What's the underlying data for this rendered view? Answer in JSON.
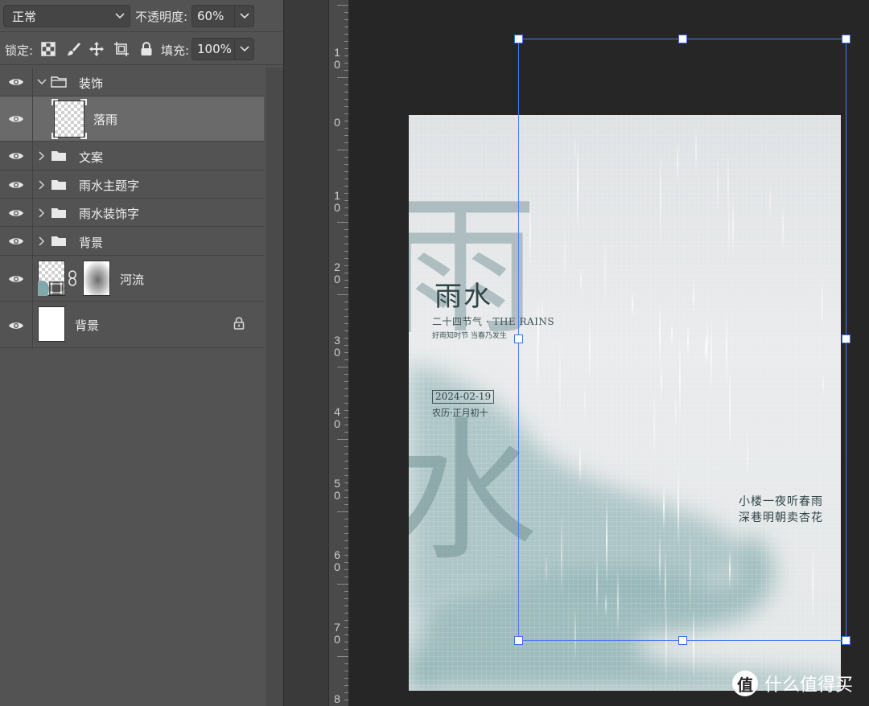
{
  "top_bar": {
    "blend_mode": "正常",
    "opacity_label": "不透明度:",
    "opacity_value": "60%",
    "lock_label": "锁定:",
    "fill_label": "填充:",
    "fill_value": "100%"
  },
  "layers": [
    {
      "name": "装饰",
      "type": "group",
      "expanded": true,
      "visible": true
    },
    {
      "name": "落雨",
      "type": "layer",
      "selected": true,
      "visible": true
    },
    {
      "name": "文案",
      "type": "group",
      "expanded": false,
      "visible": true
    },
    {
      "name": "雨水主题字",
      "type": "group",
      "expanded": false,
      "visible": true
    },
    {
      "name": "雨水装饰字",
      "type": "group",
      "expanded": false,
      "visible": true
    },
    {
      "name": "背景",
      "type": "group",
      "expanded": false,
      "visible": true
    },
    {
      "name": "河流",
      "type": "layer",
      "has_mask": true,
      "visible": true
    },
    {
      "name": "背景",
      "type": "layer",
      "locked": true,
      "visible": true
    }
  ],
  "ruler": {
    "labels": [
      "1 0",
      "0",
      "1 0",
      "2 0",
      "3 0",
      "4 0",
      "5 0",
      "6 0",
      "7 0",
      "8"
    ]
  },
  "poster": {
    "big_char_1": "雨",
    "big_char_2": "水",
    "title": "雨水",
    "subtitle": "二十四节气 · THE RAINS",
    "tagline": "好雨知时节 当春乃发生",
    "date": "2024-02-19",
    "lunar": "农历·正月初十",
    "poem_line_1": "小楼一夜听春雨",
    "poem_line_2": "深巷明朝卖杏花"
  },
  "watermark": {
    "logo_char": "值",
    "text": "什么值得买"
  },
  "colors": {
    "panel_bg": "#535353",
    "selected_layer": "#6a6a6a",
    "canvas_bg": "#262626",
    "selection": "#4a7cf0",
    "river_teal": "#7fa9ab",
    "poster_text": "#2f4446"
  }
}
